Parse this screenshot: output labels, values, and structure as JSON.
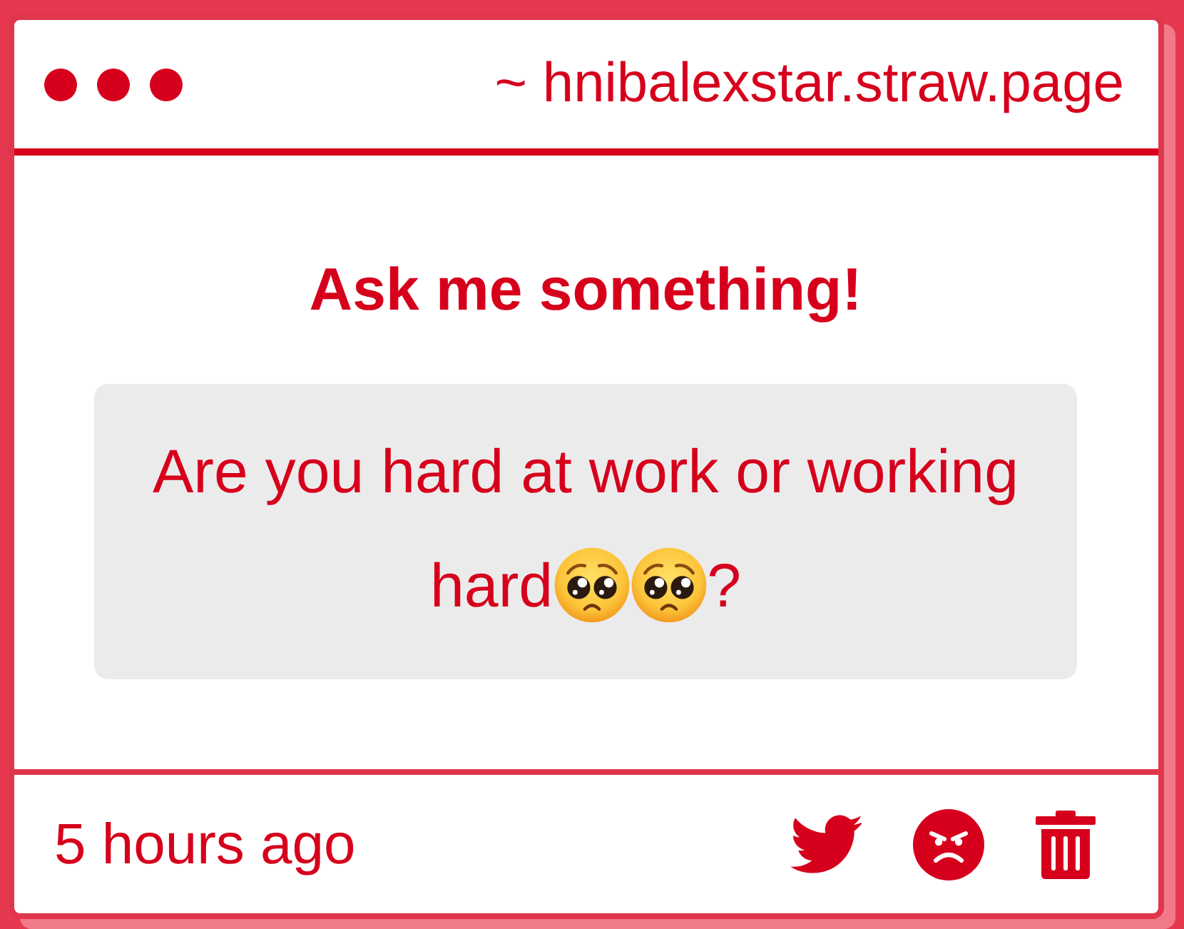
{
  "window": {
    "address": "~ hnibalexstar.straw.page"
  },
  "prompt": {
    "title": "Ask me something!"
  },
  "question": {
    "lines": [
      {
        "segments": [
          {
            "kind": "text",
            "text": "Are you hard at work or working"
          }
        ]
      },
      {
        "segments": [
          {
            "kind": "text",
            "text": "hard"
          },
          {
            "kind": "emoji"
          },
          {
            "kind": "emoji"
          },
          {
            "kind": "text",
            "text": "?"
          }
        ]
      }
    ]
  },
  "footer": {
    "time": "5 hours ago"
  }
}
